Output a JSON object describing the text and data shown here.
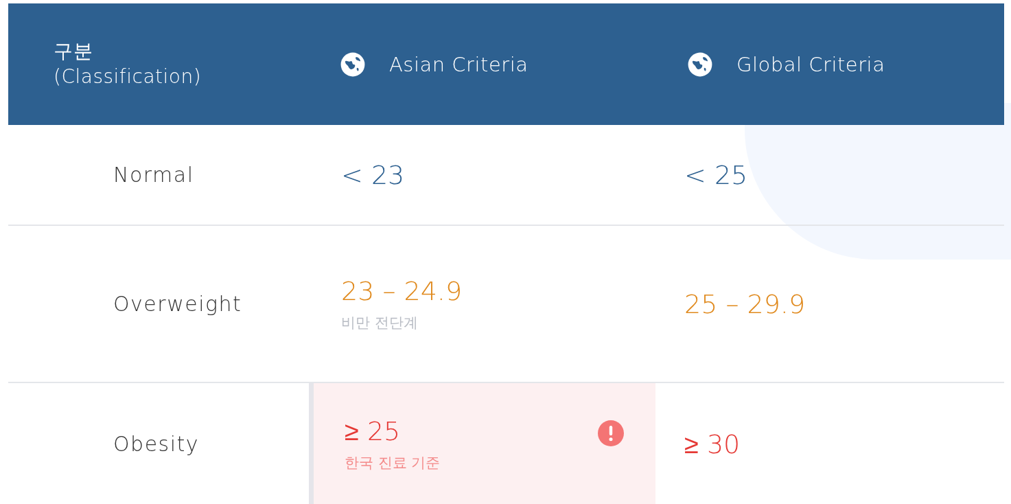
{
  "table": {
    "columns": [
      {
        "label": "구분\n(Classification)",
        "kind": "text"
      },
      {
        "label": "Asian Criteria",
        "kind": "globe"
      },
      {
        "label": "Global Criteria",
        "kind": "globe"
      }
    ],
    "rows": [
      {
        "category": "Normal",
        "kind": "normal",
        "asian": {
          "value": "< 23",
          "highlighted": false
        },
        "global": {
          "value": "< 25"
        }
      },
      {
        "category": "Overweight",
        "kind": "overweight",
        "asian": {
          "value": "23 – 24.9",
          "note": "비만 전단계",
          "highlighted": false
        },
        "global": {
          "value": "25 – 29.9"
        }
      },
      {
        "category": "Obesity",
        "kind": "obesity",
        "asian": {
          "value": "≥ 25",
          "note": "한국 진료 기준",
          "highlighted": true
        },
        "global": {
          "value": "≥ 30"
        }
      }
    ]
  }
}
